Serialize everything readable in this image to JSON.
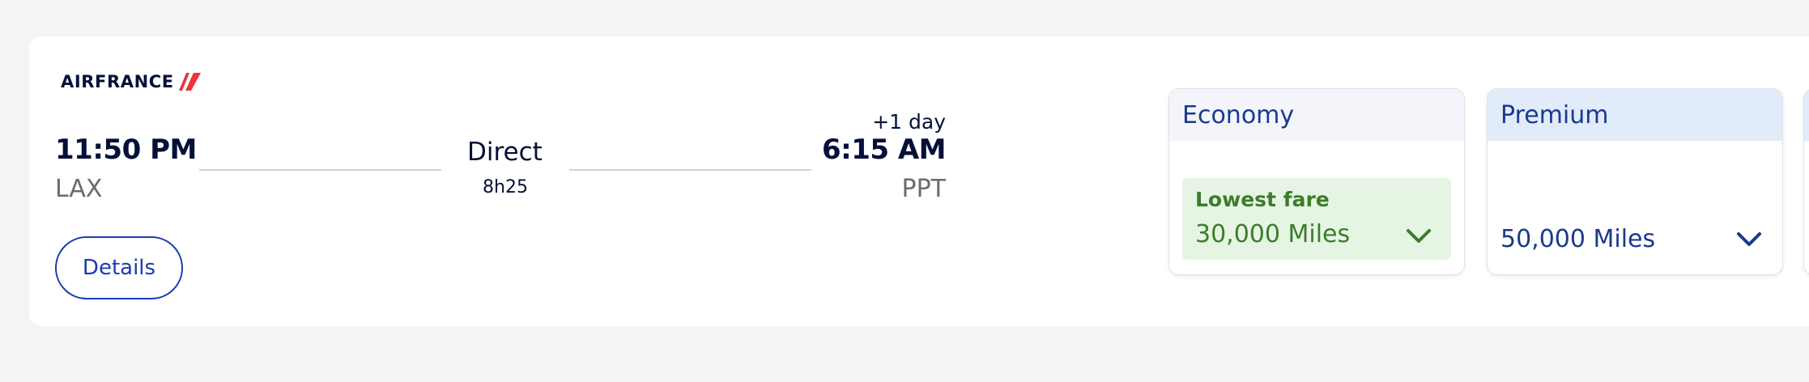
{
  "flight": {
    "airline": "AIRFRANCE",
    "departure": {
      "time": "11:50 PM",
      "airport": "LAX"
    },
    "arrival": {
      "time": "6:15 AM",
      "airport": "PPT",
      "day_offset": "+1 day"
    },
    "stops": "Direct",
    "duration": "8h25",
    "details_label": "Details"
  },
  "fares": [
    {
      "cabin": "Economy",
      "badge": "Lowest fare",
      "price": "30,000 Miles"
    },
    {
      "cabin": "Premium",
      "price": "50,000 Miles"
    }
  ],
  "colors": {
    "navy": "#051039",
    "brand_blue": "#1a3cb0",
    "fare_blue": "#1a3a8c",
    "lowest_green": "#3b7d2a",
    "lowest_bg": "#e6f5e3",
    "logo_red": "#e8353b"
  },
  "icons": {
    "logo_mark": "airfrance-logo-icon",
    "expand": "chevron-down-icon"
  }
}
